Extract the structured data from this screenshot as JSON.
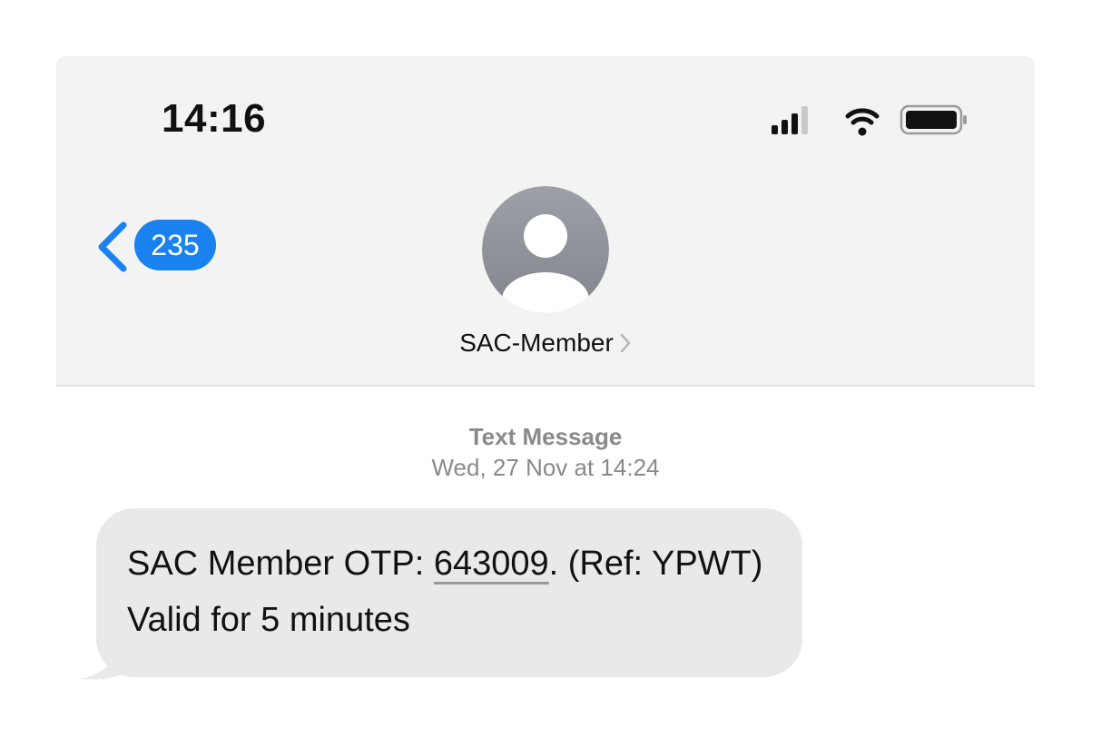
{
  "status_bar": {
    "time": "14:16",
    "icons": [
      "cellular-signal-icon",
      "wifi-icon",
      "battery-icon"
    ]
  },
  "nav": {
    "back_count": "235",
    "contact_name": "SAC-Member"
  },
  "conversation": {
    "label": "Text Message",
    "date": "Wed, 27 Nov at 14:24"
  },
  "message": {
    "prefix": "SAC Member OTP: ",
    "otp": "643009",
    "suffix": ". (Ref: YPWT) Valid for 5 minutes"
  },
  "colors": {
    "accent": "#1a82ef",
    "header_bg": "#f3f3f3",
    "bubble_bg": "#e9e9eb",
    "meta_text": "#8a8a8e"
  }
}
